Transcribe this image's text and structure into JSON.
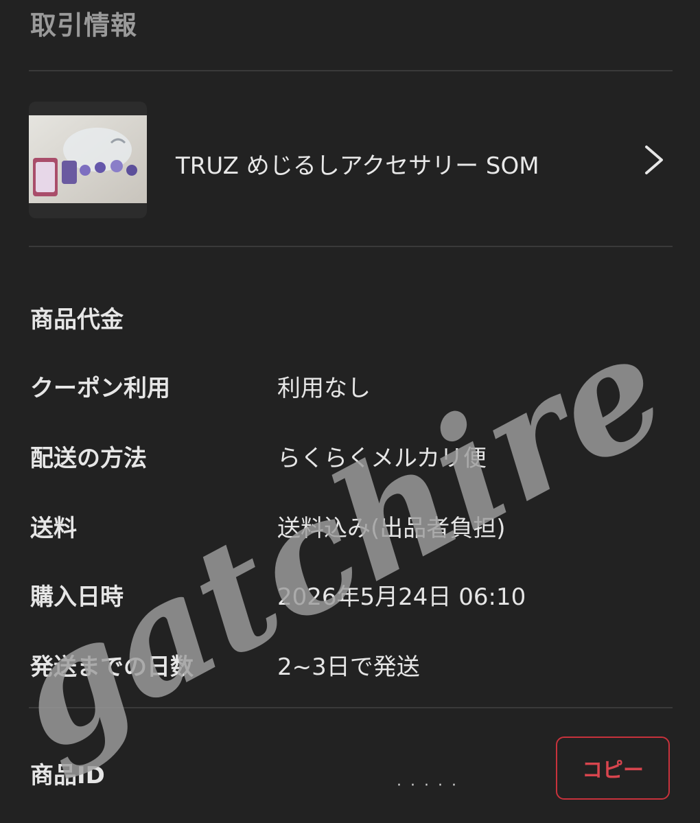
{
  "header": {
    "title": "取引情報"
  },
  "item": {
    "name": "TRUZ めじるしアクセサリー SOM",
    "thumbnail_icon": "product-photo",
    "chevron_icon": "chevron-right-icon"
  },
  "details": [
    {
      "label": "商品代金",
      "value": ""
    },
    {
      "label": "クーポン利用",
      "value": "利用なし"
    },
    {
      "label": "配送の方法",
      "value": "らくらくメルカリ便"
    },
    {
      "label": "送料",
      "value": "送料込み(出品者負担)"
    },
    {
      "label": "購入日時",
      "value": "2026年5月24日 06:10"
    },
    {
      "label": "発送までの日数",
      "value": "2~3日で発送"
    }
  ],
  "product_id": {
    "label": "商品ID",
    "masked": "· · · · ·",
    "copy_label": "コピー"
  },
  "watermark": {
    "text": "gatchire"
  },
  "colors": {
    "background": "#222222",
    "text": "#e6e6e6",
    "muted": "#9a9a9a",
    "accent": "#c8323c",
    "divider": "#3a3a3a"
  }
}
